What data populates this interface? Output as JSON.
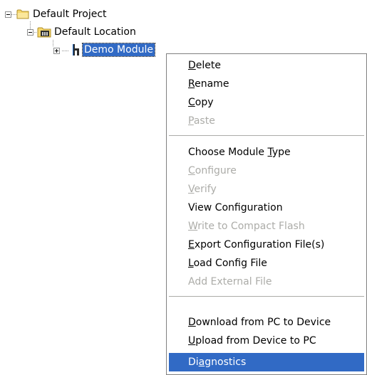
{
  "tree": {
    "project": {
      "label": "Default Project",
      "icon": "folder-icon"
    },
    "location": {
      "label": "Default Location",
      "icon": "location-folder-icon"
    },
    "module": {
      "label": "Demo Module",
      "icon": "module-icon",
      "selected": true
    }
  },
  "context_menu": {
    "groups": [
      [
        {
          "label": "Delete",
          "mnemonic": "D",
          "enabled": true
        },
        {
          "label": "Rename",
          "mnemonic": "R",
          "enabled": true
        },
        {
          "label": "Copy",
          "mnemonic": "C",
          "enabled": true
        },
        {
          "label": "Paste",
          "mnemonic": "P",
          "enabled": false
        }
      ],
      [
        {
          "label": "Choose Module Type",
          "mnemonic": "T",
          "enabled": true
        },
        {
          "label": "Configure",
          "mnemonic": "C",
          "enabled": false
        },
        {
          "label": "Verify",
          "mnemonic": "V",
          "enabled": false
        },
        {
          "label": "View Configuration",
          "mnemonic": "",
          "enabled": true
        },
        {
          "label": "Write to Compact Flash",
          "mnemonic": "W",
          "enabled": false
        },
        {
          "label": "Export Configuration File(s)",
          "mnemonic": "E",
          "enabled": true
        },
        {
          "label": "Load Config File",
          "mnemonic": "L",
          "enabled": true
        },
        {
          "label": "Add External File",
          "mnemonic": "",
          "enabled": false
        }
      ],
      [
        {
          "label": "Download from PC to Device",
          "mnemonic": "D",
          "enabled": true
        },
        {
          "label": "Upload from Device to PC",
          "mnemonic": "U",
          "enabled": true
        },
        {
          "label": "Diagnostics",
          "mnemonic": "a",
          "enabled": true,
          "highlighted": true
        }
      ]
    ]
  },
  "colors": {
    "selection": "#316ac5",
    "disabled_text": "#acaca8",
    "folder_yellow": "#f5d66b"
  }
}
